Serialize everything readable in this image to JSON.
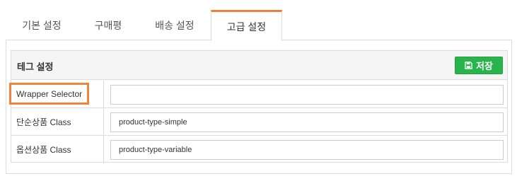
{
  "tabs": [
    {
      "label": "기본 설정"
    },
    {
      "label": "구매평"
    },
    {
      "label": "배송 설정"
    },
    {
      "label": "고급 설정",
      "active": true
    }
  ],
  "accent_color": "#e98237",
  "settings": {
    "title": "테그 설정",
    "save_button": {
      "label": "저장",
      "icon": "save-icon",
      "color": "#28b44a"
    },
    "rows": [
      {
        "label": "Wrapper Selector",
        "value": "",
        "highlighted": true
      },
      {
        "label": "단순상품 Class",
        "value": "product-type-simple"
      },
      {
        "label": "옵션상품 Class",
        "value": "product-type-variable"
      }
    ]
  },
  "highlight_color": "#f0843a"
}
